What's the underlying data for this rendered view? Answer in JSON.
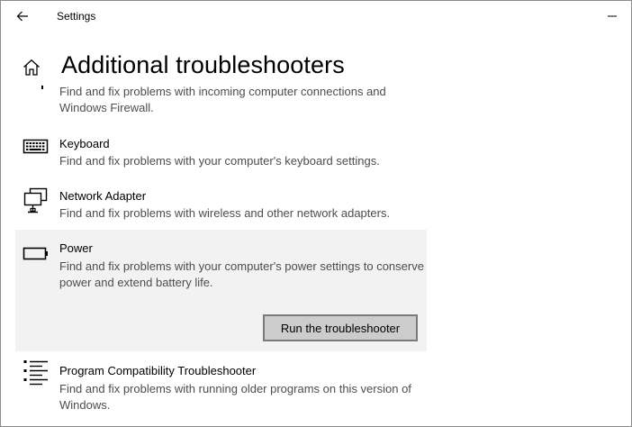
{
  "window": {
    "app_title": "Settings"
  },
  "header": {
    "title": "Additional troubleshooters"
  },
  "troubleshooters": [
    {
      "name": "",
      "description": "Find and fix problems with incoming computer connections and Windows Firewall.",
      "icon": "incoming-connections-icon"
    },
    {
      "name": "Keyboard",
      "description": "Find and fix problems with your computer's keyboard settings.",
      "icon": "keyboard-icon"
    },
    {
      "name": "Network Adapter",
      "description": "Find and fix problems with wireless and other network adapters.",
      "icon": "network-adapter-icon"
    },
    {
      "name": "Power",
      "description": "Find and fix problems with your computer's power settings to conserve power and extend battery life.",
      "icon": "battery-icon",
      "selected": true,
      "button_label": "Run the troubleshooter"
    },
    {
      "name": "Program Compatibility Troubleshooter",
      "description": "Find and fix problems with running older programs on this version of Windows.",
      "icon": "program-compatibility-icon"
    }
  ],
  "colors": {
    "selected_background": "#f2f2f2",
    "description_text": "#4d4d4d",
    "button_background": "#cccccc",
    "button_border": "#7a7a7a"
  }
}
